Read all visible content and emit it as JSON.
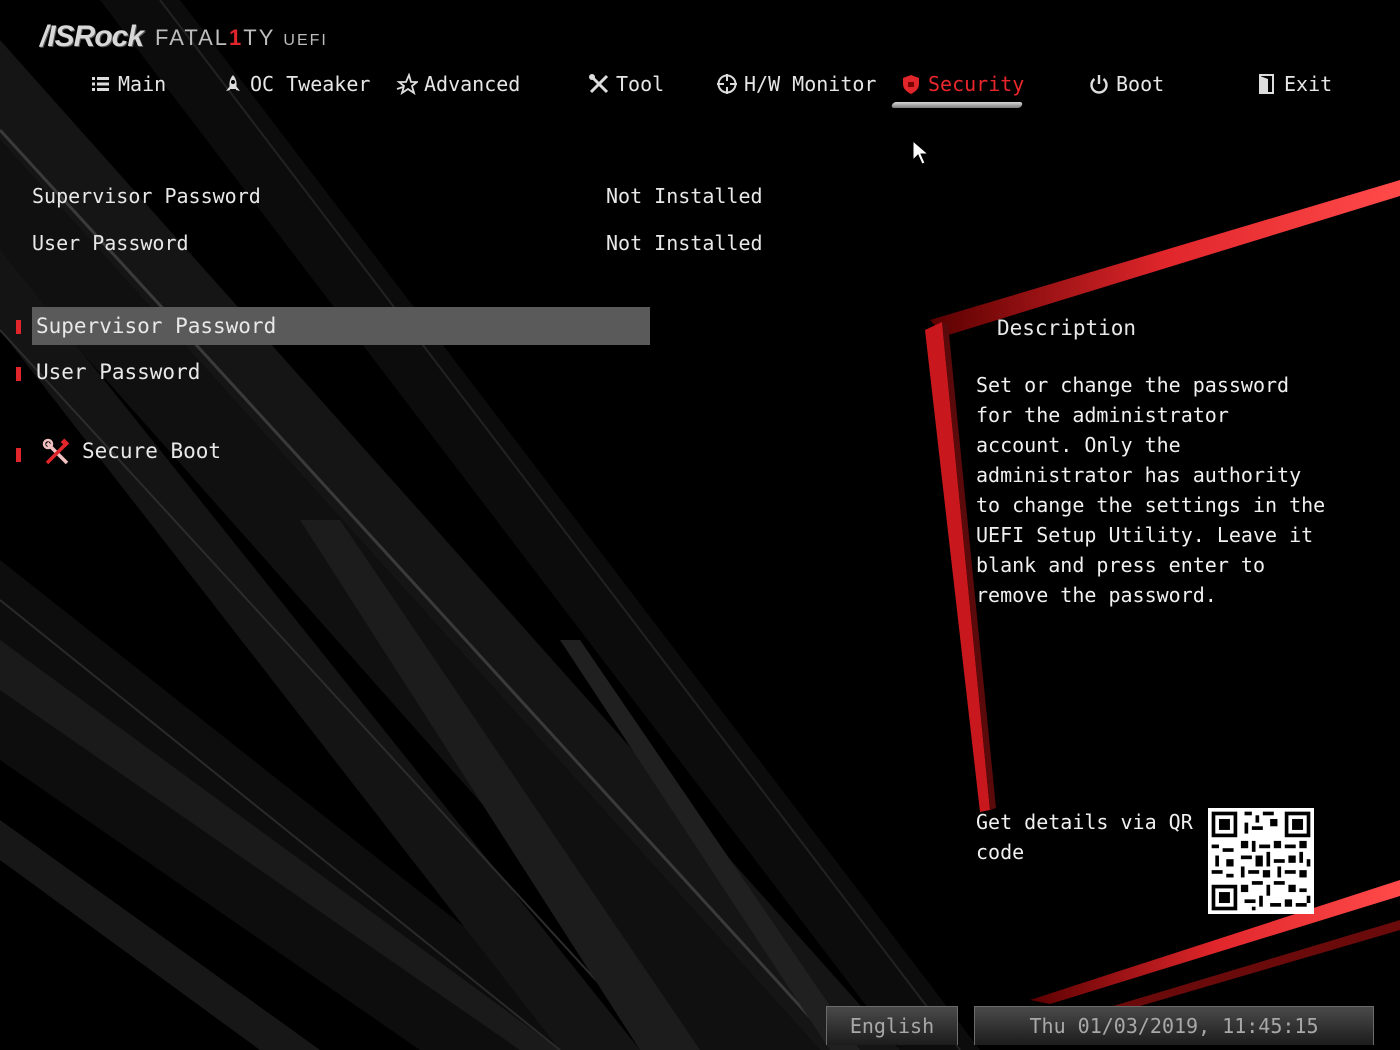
{
  "brand": {
    "name": "/ISRock",
    "product_pre": "FATAL",
    "product_one": "1",
    "product_post": "TY",
    "suffix": "UEFI"
  },
  "nav": {
    "items": [
      {
        "label": "Main",
        "icon": "list-icon"
      },
      {
        "label": "OC Tweaker",
        "icon": "rocket-icon"
      },
      {
        "label": "Advanced",
        "icon": "star-icon"
      },
      {
        "label": "Tool",
        "icon": "tools-icon"
      },
      {
        "label": "H/W Monitor",
        "icon": "crosshair-icon"
      },
      {
        "label": "Security",
        "icon": "shield-icon"
      },
      {
        "label": "Boot",
        "icon": "power-icon"
      },
      {
        "label": "Exit",
        "icon": "exit-door-icon"
      }
    ],
    "active": "Security"
  },
  "status": {
    "supervisor_label": "Supervisor Password",
    "supervisor_value": "Not Installed",
    "user_label": "User Password",
    "user_value": "Not Installed"
  },
  "menu": {
    "supervisor_password": "Supervisor Password",
    "user_password": "User Password",
    "secure_boot": "Secure Boot"
  },
  "description": {
    "title": "Description",
    "text": "Set or change the password for the administrator account. Only the administrator has authority to change the settings in the UEFI Setup Utility. Leave it blank and press enter to remove the password."
  },
  "qr": {
    "text": "Get details via QR code"
  },
  "footer": {
    "language": "English",
    "datetime": "Thu 01/03/2019, 11:45:15"
  },
  "colors": {
    "accent": "#e0262b",
    "background": "#000000",
    "text": "#e8e8e8",
    "selected_bg": "#5a5a5a"
  }
}
